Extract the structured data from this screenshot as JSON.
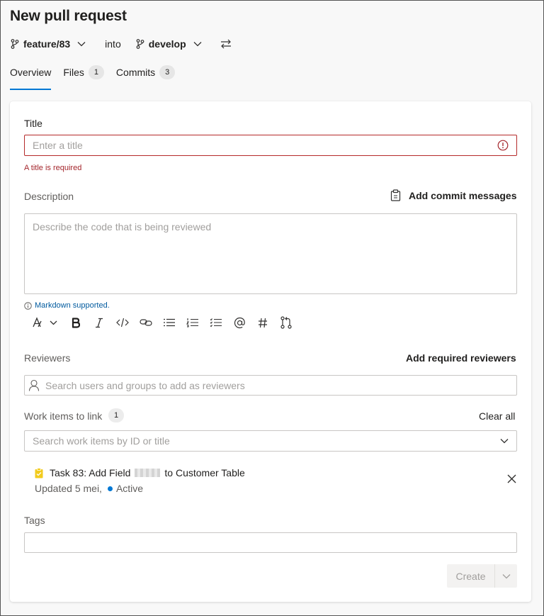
{
  "page": {
    "title": "New pull request"
  },
  "branches": {
    "source": "feature/83",
    "into_label": "into",
    "target": "develop"
  },
  "tabs": [
    {
      "label": "Overview",
      "count": ""
    },
    {
      "label": "Files",
      "count": "1"
    },
    {
      "label": "Commits",
      "count": "3"
    }
  ],
  "form": {
    "title_label": "Title",
    "title_placeholder": "Enter a title",
    "title_error": "A title is required",
    "description_label": "Description",
    "add_commit_messages": "Add commit messages",
    "description_placeholder": "Describe the code that is being reviewed",
    "markdown_note": "Markdown supported.",
    "reviewers_label": "Reviewers",
    "add_required_reviewers": "Add required reviewers",
    "reviewers_placeholder": "Search users and groups to add as reviewers",
    "work_items_label": "Work items to link",
    "work_items_count": "1",
    "clear_all": "Clear all",
    "work_items_placeholder": "Search work items by ID or title",
    "tags_label": "Tags",
    "create_label": "Create"
  },
  "work_item": {
    "title_prefix": "Task 83: Add Field",
    "title_suffix": "to Customer Table",
    "updated": "Updated 5 mei,",
    "state": "Active",
    "state_color": "#0078d4",
    "icon_color": "#f2cb1d"
  },
  "colors": {
    "accent": "#0078d4",
    "error": "#a4262c"
  }
}
